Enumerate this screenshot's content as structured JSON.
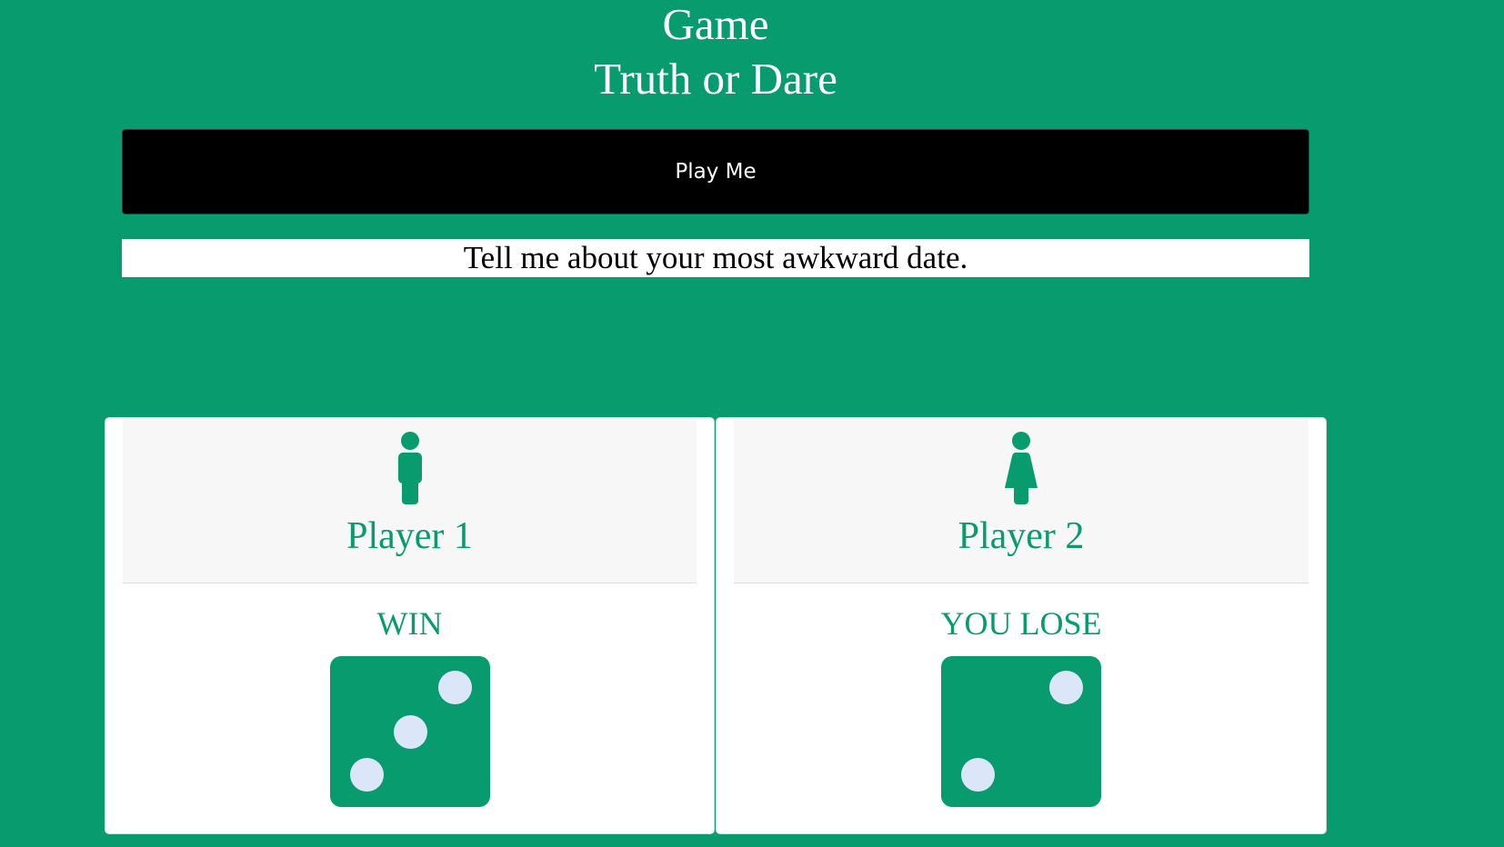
{
  "header": {
    "line1": "Game",
    "line2": "Truth or Dare"
  },
  "play_button": {
    "label": "Play Me"
  },
  "prompt": {
    "text": "Tell me about your most awkward date."
  },
  "players": [
    {
      "name": "Player 1",
      "icon": "male-person-icon",
      "result": "WIN",
      "die_value": 3
    },
    {
      "name": "Player 2",
      "icon": "female-person-icon",
      "result": "YOU LOSE",
      "die_value": 2
    }
  ],
  "colors": {
    "background": "#079b6e",
    "accent": "#079b6e",
    "pip": "#dbe7f8",
    "button": "#000000"
  }
}
